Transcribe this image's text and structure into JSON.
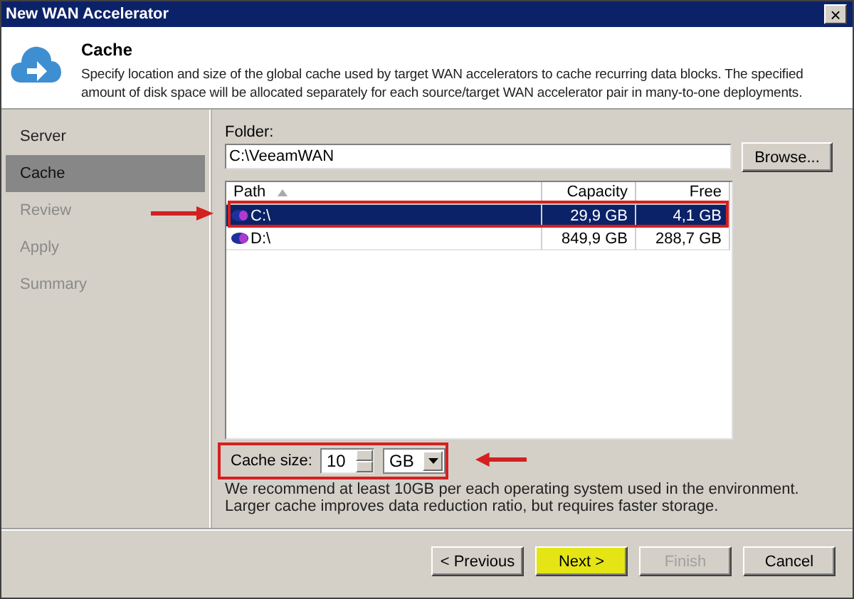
{
  "window": {
    "title": "New WAN Accelerator",
    "close": "×"
  },
  "header": {
    "title": "Cache",
    "description": "Specify location and size of the global cache used by target WAN accelerators to cache recurring data blocks. The specified amount of disk space will be allocated separately for each source/target WAN accelerator pair in many-to-one deployments."
  },
  "sidebar": {
    "items": [
      {
        "label": "Server",
        "selected": false,
        "disabled": false
      },
      {
        "label": "Cache",
        "selected": true,
        "disabled": false
      },
      {
        "label": "Review",
        "selected": false,
        "disabled": true
      },
      {
        "label": "Apply",
        "selected": false,
        "disabled": true
      },
      {
        "label": "Summary",
        "selected": false,
        "disabled": true
      }
    ]
  },
  "folder": {
    "label": "Folder:",
    "value": "C:\\VeeamWAN",
    "browse": "Browse..."
  },
  "table": {
    "columns": [
      "Path",
      "Capacity",
      "Free"
    ],
    "rows": [
      {
        "path": "C:\\",
        "capacity": "29,9 GB",
        "free": "4,1 GB",
        "selected": true,
        "annotated": true
      },
      {
        "path": "D:\\",
        "capacity": "849,9 GB",
        "free": "288,7 GB",
        "selected": false,
        "annotated": false
      }
    ]
  },
  "cache_size": {
    "label": "Cache size:",
    "value": "10",
    "unit": "GB",
    "annotated": true
  },
  "hint": "We recommend at least 10GB per each operating system used in the environment. Larger cache improves data reduction ratio, but requires faster storage.",
  "buttons": [
    {
      "label": "< Previous",
      "disabled": false,
      "highlighted": false
    },
    {
      "label": "Next >",
      "disabled": false,
      "highlighted": true
    },
    {
      "label": "Finish",
      "disabled": true,
      "highlighted": false
    },
    {
      "label": "Cancel",
      "disabled": false,
      "highlighted": false
    }
  ]
}
